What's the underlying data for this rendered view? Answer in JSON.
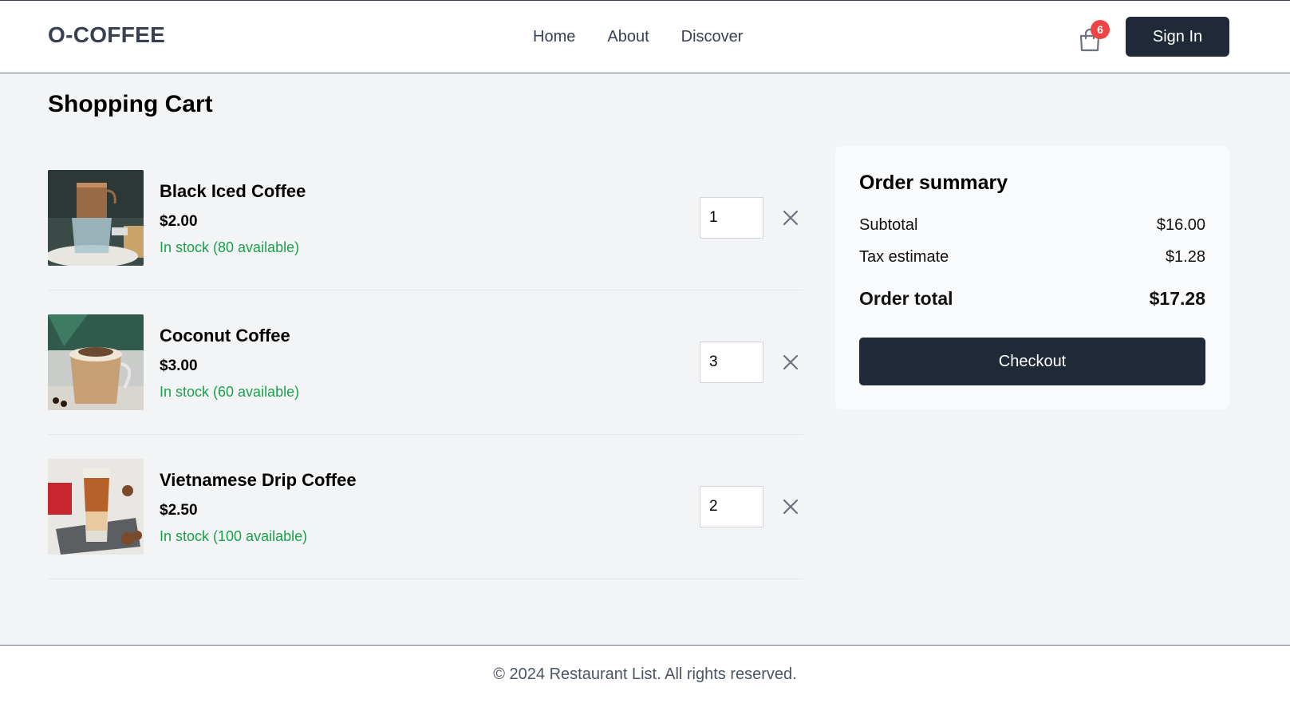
{
  "brand": {
    "logo": "O-COFFEE"
  },
  "nav": {
    "items": [
      {
        "label": "Home"
      },
      {
        "label": "About"
      },
      {
        "label": "Discover"
      }
    ]
  },
  "header": {
    "cart_count": "6",
    "sign_in": "Sign In",
    "cart_icon": "shopping-bag-icon"
  },
  "page": {
    "title": "Shopping Cart"
  },
  "cart": {
    "items": [
      {
        "name": "Black Iced Coffee",
        "price": "$2.00",
        "stock": "In stock (80 available)",
        "quantity": "1",
        "image": "black-iced-coffee-photo"
      },
      {
        "name": "Coconut Coffee",
        "price": "$3.00",
        "stock": "In stock (60 available)",
        "quantity": "3",
        "image": "coconut-coffee-photo"
      },
      {
        "name": "Vietnamese Drip Coffee",
        "price": "$2.50",
        "stock": "In stock (100 available)",
        "quantity": "2",
        "image": "vietnamese-drip-coffee-photo"
      }
    ],
    "remove_icon": "close-icon"
  },
  "summary": {
    "title": "Order summary",
    "subtotal_label": "Subtotal",
    "subtotal": "$16.00",
    "tax_label": "Tax estimate",
    "tax": "$1.28",
    "total_label": "Order total",
    "total": "$17.28",
    "checkout": "Checkout"
  },
  "footer": {
    "copyright": "© 2024 Restaurant List. All rights reserved."
  },
  "colors": {
    "primary": "#1f2937",
    "stock": "#16a34a",
    "badge": "#ef4444",
    "background": "#f3f4f6"
  }
}
